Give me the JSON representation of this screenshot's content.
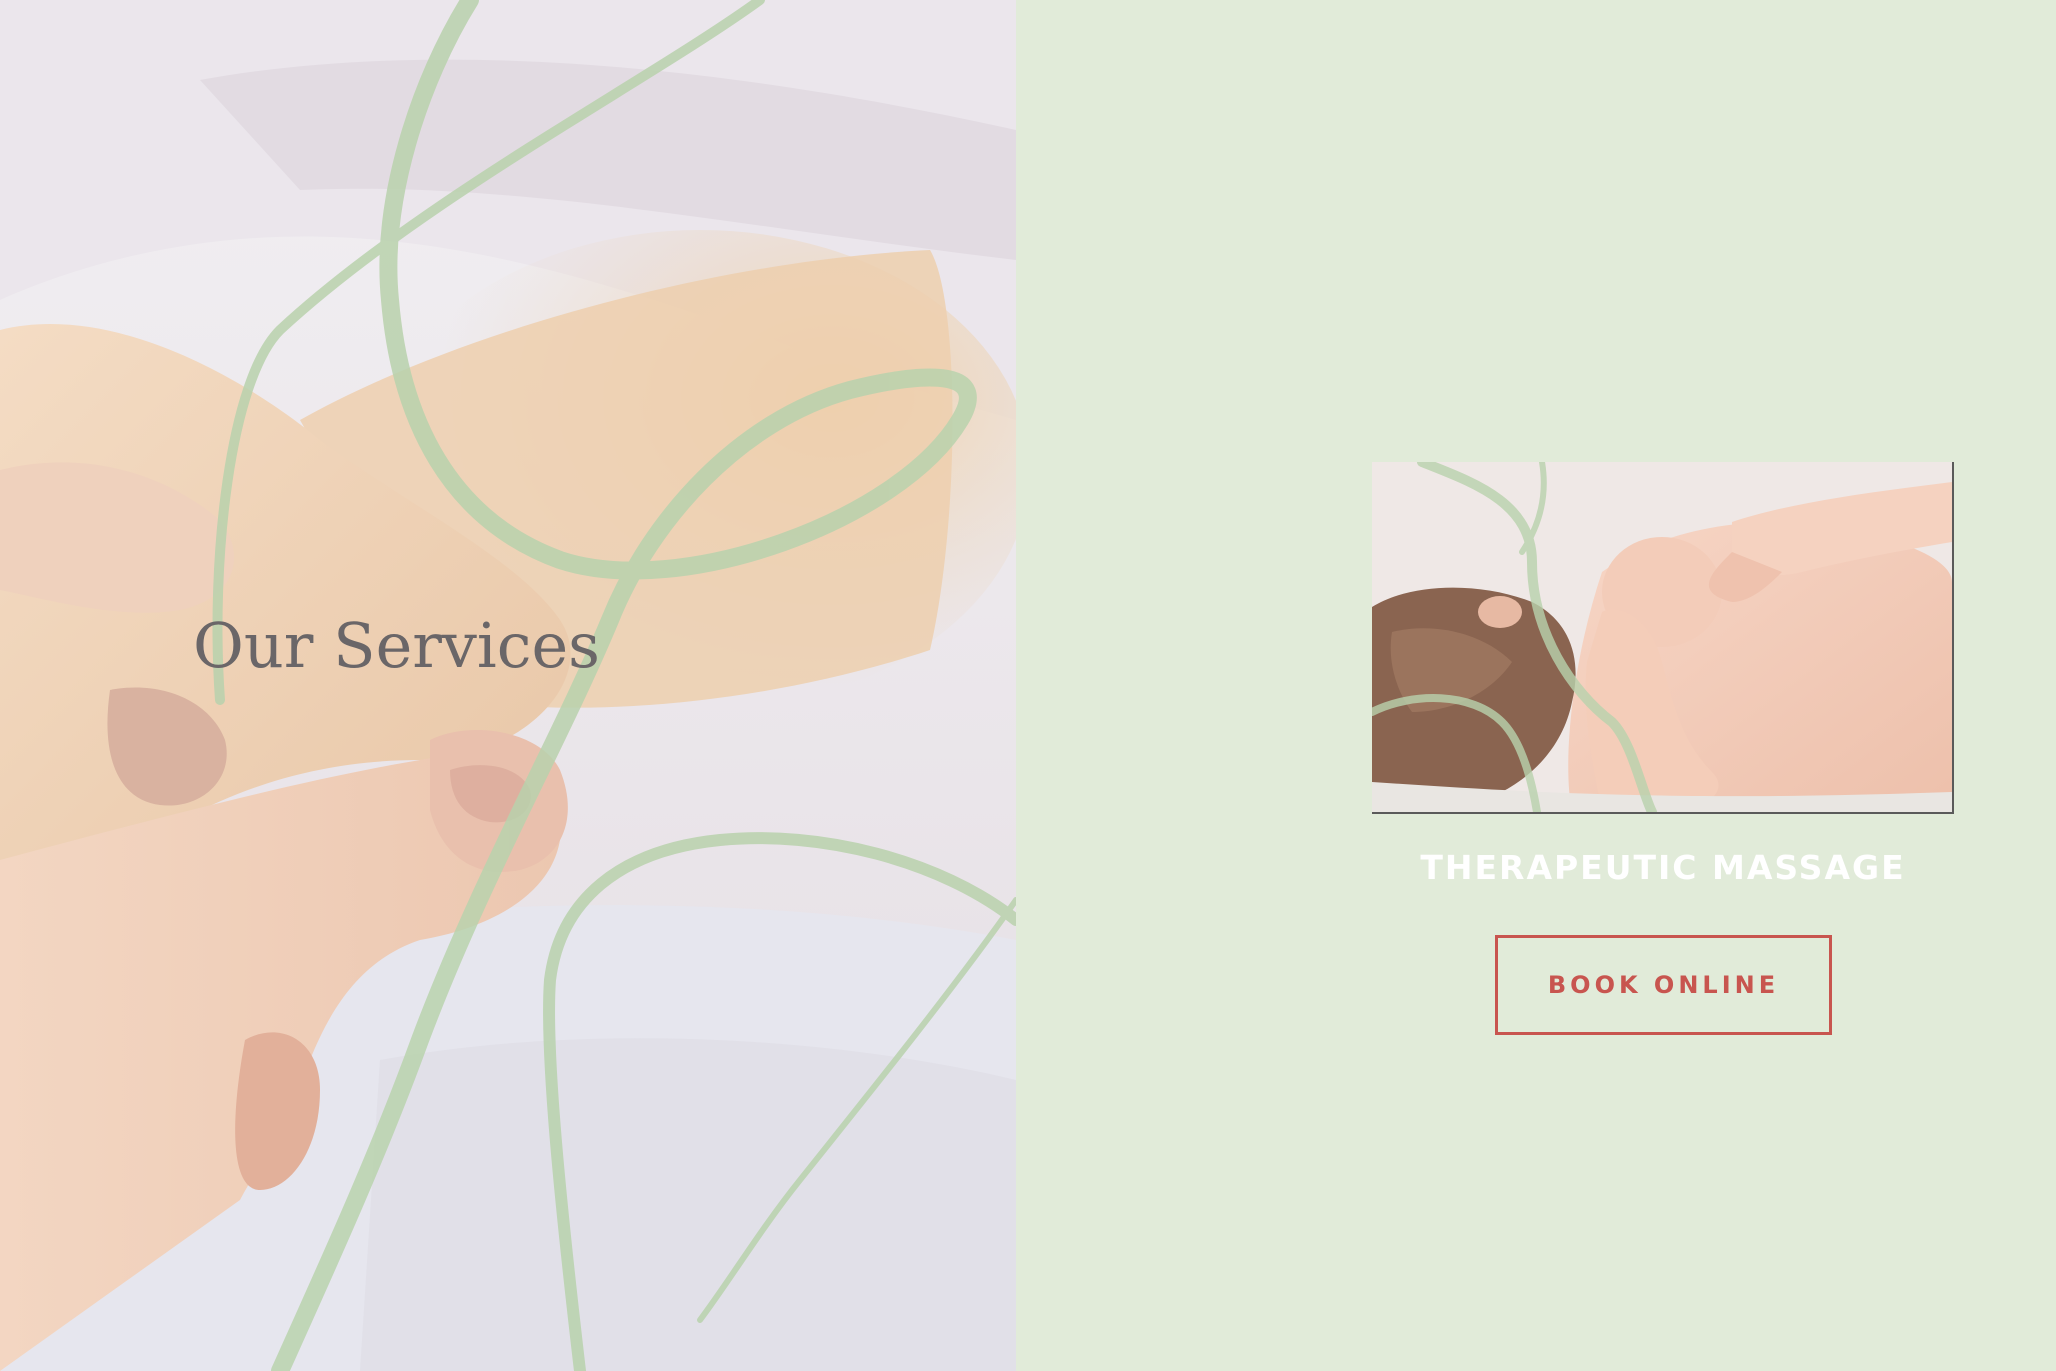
{
  "hero": {
    "title": "Our Services",
    "image": "massage-hands-image"
  },
  "service": {
    "image": "shoulder-massage-image",
    "title": "THERAPEUTIC MASSAGE",
    "button_label": "BOOK ONLINE"
  },
  "colors": {
    "background": "#e1ebd9",
    "accent": "#c8554f",
    "vine": "#b7cfac",
    "title_text": "#6a6668",
    "service_title": "#ffffff"
  }
}
